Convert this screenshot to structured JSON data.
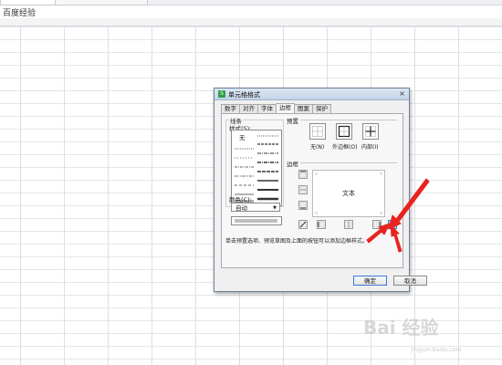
{
  "browser": {
    "brand_text": "百度经验"
  },
  "dialog": {
    "title": "单元格格式",
    "close_glyph": "×",
    "tabs": [
      {
        "label": "数字"
      },
      {
        "label": "对齐"
      },
      {
        "label": "字体"
      },
      {
        "label": "边框"
      },
      {
        "label": "图案"
      },
      {
        "label": "保护"
      }
    ],
    "active_tab": "边框",
    "line": {
      "group_label": "线条",
      "style_label": "样式(S):",
      "none_label": "无",
      "color_label": "颜色(C):",
      "color_value": "自动"
    },
    "presets": {
      "section_label": "预置",
      "items": [
        {
          "label": "无(N)"
        },
        {
          "label": "外边框(O)"
        },
        {
          "label": "内部(I)"
        }
      ]
    },
    "border": {
      "section_label": "边框",
      "preview_text": "文本"
    },
    "hint": "单击预置选项、预览草图及上面的按钮可以添加边框样式。",
    "ok_label": "确定",
    "cancel_label": "取消"
  },
  "annotation": {
    "arrow_color": "#e8231f"
  },
  "watermark": {
    "text": "Bai 经验",
    "url_text": "jingyan.baidu.com"
  }
}
